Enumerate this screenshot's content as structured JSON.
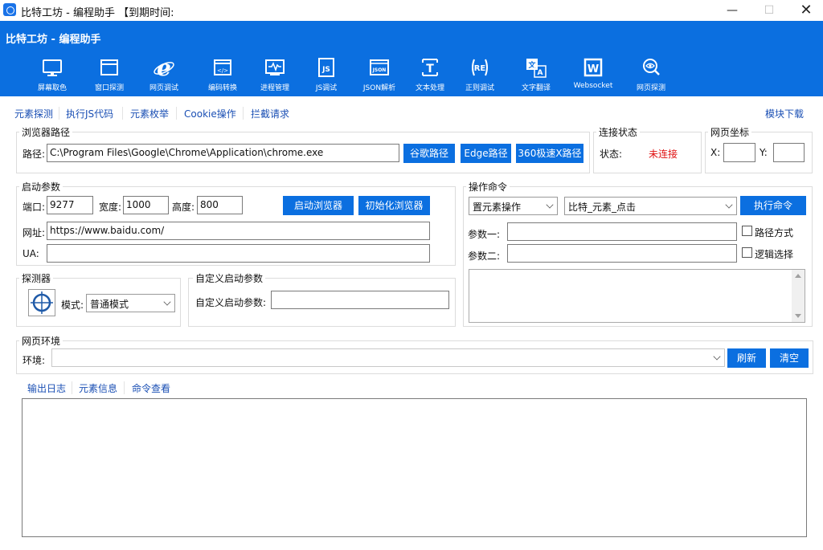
{
  "window": {
    "title": "比特工坊 - 编程助手 【到期时间:",
    "controls": {
      "minimize": "—",
      "maximize": "☐",
      "close": "✕"
    }
  },
  "header": {
    "title": "比特工坊 - 编程助手"
  },
  "toolbar": [
    {
      "label": "屏幕取色",
      "icon": "monitor-icon"
    },
    {
      "label": "窗口探测",
      "icon": "window-icon"
    },
    {
      "label": "网页调试",
      "icon": "ie-icon"
    },
    {
      "label": "编码转换",
      "icon": "code-icon"
    },
    {
      "label": "进程管理",
      "icon": "pulse-icon"
    },
    {
      "label": "JS调试",
      "icon": "js-icon"
    },
    {
      "label": "JSON解析",
      "icon": "json-icon"
    },
    {
      "label": "文本处理",
      "icon": "text-icon"
    },
    {
      "label": "正则调试",
      "icon": "regex-icon"
    },
    {
      "label": "文字翻译",
      "icon": "translate-icon"
    },
    {
      "label": "Websocket",
      "icon": "websocket-icon"
    },
    {
      "label": "网页探测",
      "icon": "eye-icon"
    }
  ],
  "top_tabs": [
    "元素探测",
    "执行JS代码",
    "元素枚举",
    "Cookie操作",
    "拦截请求"
  ],
  "module_download": "模块下载",
  "browser_path": {
    "group_title": "浏览器路径",
    "label": "路径:",
    "value": "C:\\Program Files\\Google\\Chrome\\Application\\chrome.exe",
    "btn_chrome": "谷歌路径",
    "btn_edge": "Edge路径",
    "btn_360": "360极速X路径"
  },
  "connection": {
    "group_title": "连接状态",
    "label": "状态:",
    "status": "未连接",
    "status_color": "#e01010"
  },
  "coords": {
    "group_title": "网页坐标",
    "x_label": "X:",
    "y_label": "Y:",
    "x_value": "",
    "y_value": ""
  },
  "launch": {
    "group_title": "启动参数",
    "port_label": "端口:",
    "port": "9277",
    "width_label": "宽度:",
    "width": "1000",
    "height_label": "高度:",
    "height": "800",
    "btn_start": "启动浏览器",
    "btn_init": "初始化浏览器",
    "url_label": "网址:",
    "url": "https://www.baidu.com/",
    "ua_label": "UA:",
    "ua": ""
  },
  "command": {
    "group_title": "操作命令",
    "category": "置元素操作",
    "action": "比特_元素_点击",
    "btn_execute": "执行命令",
    "param1_label": "参数一:",
    "param1": "",
    "param2_label": "参数二:",
    "param2": "",
    "path_mode": "路径方式",
    "logic_select": "逻辑选择"
  },
  "detector": {
    "group_title": "探测器",
    "mode_label": "模式:",
    "mode": "普通模式"
  },
  "custom_launch": {
    "group_title": "自定义启动参数",
    "label": "自定义启动参数:",
    "value": ""
  },
  "env": {
    "group_title": "网页环境",
    "label": "环境:",
    "value": "",
    "btn_refresh": "刷新",
    "btn_clear": "清空"
  },
  "bottom_tabs": [
    "输出日志",
    "元素信息",
    "命令查看"
  ],
  "log": "",
  "colors": {
    "accent": "#0b6fe0",
    "tab_text": "#1a4fb4"
  }
}
